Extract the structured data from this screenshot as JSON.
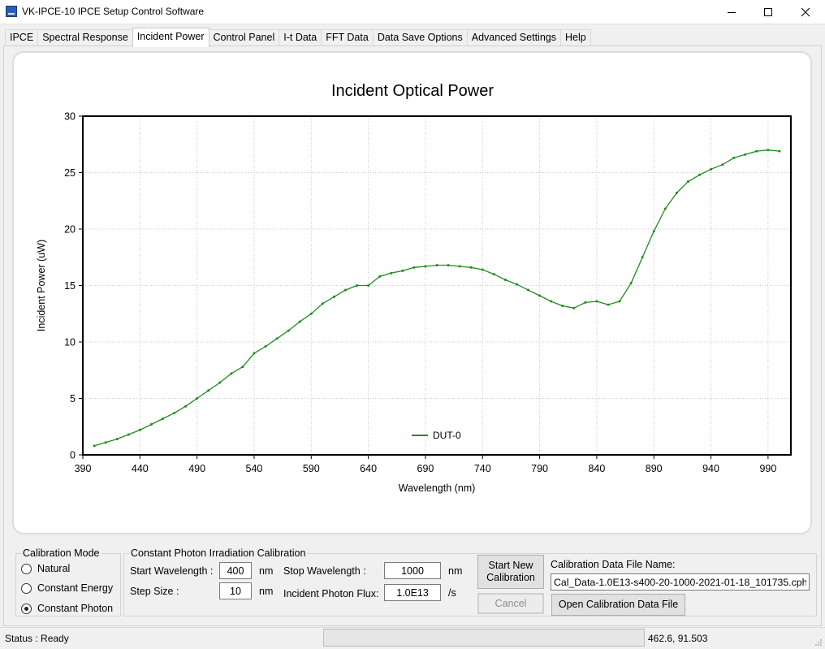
{
  "window": {
    "title": "VK-IPCE-10 IPCE Setup Control Software",
    "controls": [
      "minimize",
      "maximize",
      "close"
    ]
  },
  "tabs": [
    {
      "label": "IPCE"
    },
    {
      "label": "Spectral Response"
    },
    {
      "label": "Incident Power",
      "active": true
    },
    {
      "label": "Control Panel"
    },
    {
      "label": "I-t Data"
    },
    {
      "label": "FFT Data"
    },
    {
      "label": "Data Save Options"
    },
    {
      "label": "Advanced Settings"
    },
    {
      "label": "Help"
    }
  ],
  "chart_data": {
    "type": "line",
    "title": "Incident Optical Power",
    "xlabel": "Wavelength (nm)",
    "ylabel": "Incident Power (uW)",
    "xlim": [
      390,
      1010
    ],
    "ylim": [
      0,
      30
    ],
    "x_ticks": [
      390,
      440,
      490,
      540,
      590,
      640,
      690,
      740,
      790,
      840,
      890,
      940,
      990
    ],
    "y_ticks": [
      0,
      5,
      10,
      15,
      20,
      25,
      30
    ],
    "grid": true,
    "legend_position": "bottom-center",
    "series": [
      {
        "name": "DUT-0",
        "color": "#1e8c1e",
        "x": [
          400,
          410,
          420,
          430,
          440,
          450,
          460,
          470,
          480,
          490,
          500,
          510,
          520,
          530,
          540,
          550,
          560,
          570,
          580,
          590,
          600,
          610,
          620,
          630,
          640,
          650,
          660,
          670,
          680,
          690,
          700,
          710,
          720,
          730,
          740,
          750,
          760,
          770,
          780,
          790,
          800,
          810,
          820,
          830,
          840,
          850,
          860,
          870,
          880,
          890,
          900,
          910,
          920,
          930,
          940,
          950,
          960,
          970,
          980,
          990,
          1000
        ],
        "values": [
          0.8,
          1.1,
          1.4,
          1.8,
          2.2,
          2.7,
          3.2,
          3.7,
          4.3,
          5.0,
          5.7,
          6.4,
          7.2,
          7.8,
          9.0,
          9.6,
          10.3,
          11.0,
          11.8,
          12.5,
          13.4,
          14.0,
          14.6,
          15.0,
          15.0,
          15.8,
          16.1,
          16.3,
          16.6,
          16.7,
          16.8,
          16.8,
          16.7,
          16.6,
          16.4,
          16.0,
          15.5,
          15.1,
          14.6,
          14.1,
          13.6,
          13.2,
          13.0,
          13.5,
          13.6,
          13.3,
          13.6,
          15.2,
          17.5,
          19.8,
          21.8,
          23.2,
          24.2,
          24.8,
          25.3,
          25.7,
          26.3,
          26.6,
          26.9,
          27.0,
          26.9
        ]
      }
    ]
  },
  "calibration_mode": {
    "title": "Calibration Mode",
    "options": [
      {
        "label": "Natural",
        "checked": false
      },
      {
        "label": "Constant Energy",
        "checked": false
      },
      {
        "label": "Constant Photon",
        "checked": true
      }
    ]
  },
  "calibration": {
    "title": "Constant Photon Irradiation Calibration",
    "start_wavelength_label": "Start Wavelength :",
    "start_wavelength_value": "400",
    "stop_wavelength_label": "Stop Wavelength :",
    "stop_wavelength_value": "1000",
    "step_size_label": "Step Size :",
    "step_size_value": "10",
    "photon_flux_label": "Incident Photon Flux:",
    "photon_flux_value": "1.0E13",
    "unit_nm": "nm",
    "unit_per_s": "/s",
    "start_button": "Start New Calibration",
    "cancel_button": "Cancel",
    "file_name_label": "Calibration Data File Name:",
    "file_name_value": "Cal_Data-1.0E13-s400-20-1000-2021-01-18_101735.cph",
    "open_file_button": "Open Calibration Data File"
  },
  "status": {
    "label": "Status :",
    "value": "Ready",
    "text": "Status :  Ready",
    "coordinates": "462.6, 91.503"
  }
}
